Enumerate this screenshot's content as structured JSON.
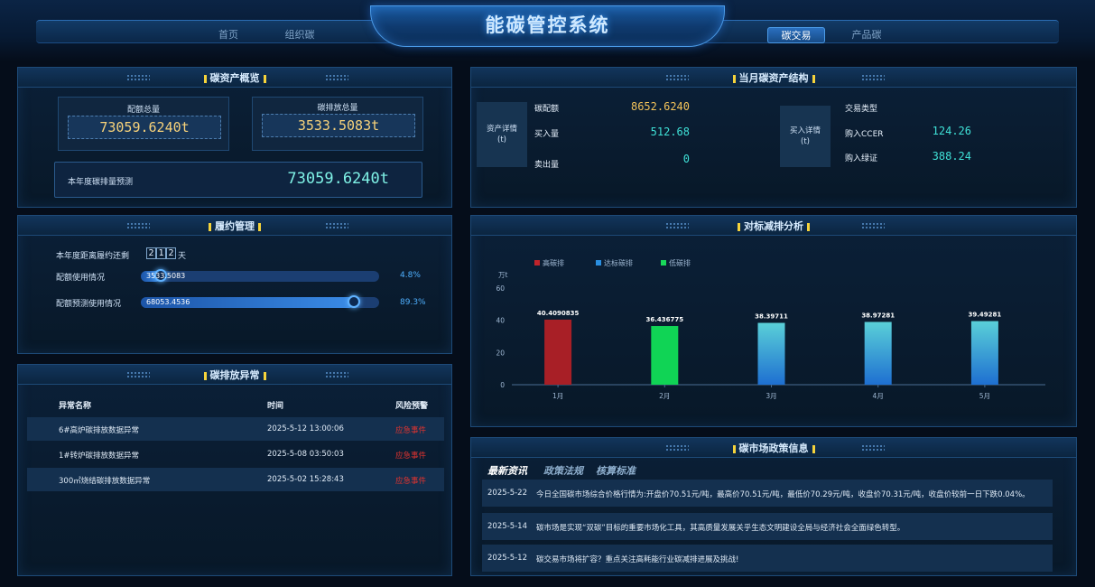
{
  "header": {
    "title": "能碳管控系统",
    "nav_left": [
      "首页",
      "组织碳"
    ],
    "nav_right": [
      "碳交易",
      "产品碳"
    ],
    "active_nav": "碳交易"
  },
  "carbon_assets": {
    "title": "碳资产概览",
    "quota_total_label": "配额总量",
    "quota_total_value": "73059.6240t",
    "emission_total_label": "碳排放总量",
    "emission_total_value": "3533.5083t",
    "forecast_label": "本年度碳排量预测",
    "forecast_value": "73059.6240t"
  },
  "compliance": {
    "title": "履约管理",
    "days_label": "本年度距离履约还剩",
    "days_digits": [
      "2",
      "1",
      "2"
    ],
    "days_unit": "天",
    "rows": [
      {
        "label": "配额使用情况",
        "value": "3533.5083",
        "percent": "4.8%",
        "fraction": 0.048
      },
      {
        "label": "配额预测使用情况",
        "value": "68053.4536",
        "percent": "89.3%",
        "fraction": 0.893
      }
    ]
  },
  "anomalies": {
    "title": "碳排放异常",
    "columns": [
      "异常名称",
      "时间",
      "风险预警"
    ],
    "rows": [
      {
        "name": "6#高炉碳排放数据异常",
        "time": "2025-5-12 13:00:06",
        "risk": "应急事件"
      },
      {
        "name": "1#转炉碳排放数据异常",
        "time": "2025-5-08 03:50:03",
        "risk": "应急事件"
      },
      {
        "name": "300㎡烧结碳排放数据异常",
        "time": "2025-5-02 15:28:43",
        "risk": "应急事件"
      }
    ]
  },
  "asset_structure": {
    "title": "当月碳资产结构",
    "asset_detail_label": "资产详情\n(t)",
    "asset_rows": [
      {
        "label": "碳配额",
        "value": "8652.6240",
        "color": "#f3c35a"
      },
      {
        "label": "买入量",
        "value": "512.68",
        "color": "#3fe0d6"
      },
      {
        "label": "卖出量",
        "value": "0",
        "color": "#3fe0d6"
      }
    ],
    "buy_detail_label": "买入详情\n(t)",
    "trade_type_label": "交易类型",
    "buy_rows": [
      {
        "label": "购入CCER",
        "value": "124.26"
      },
      {
        "label": "购入绿证",
        "value": "388.24"
      }
    ]
  },
  "benchmark": {
    "title": "对标减排分析"
  },
  "chart_data": {
    "type": "bar",
    "categories": [
      "1月",
      "2月",
      "3月",
      "4月",
      "5月"
    ],
    "values": [
      40.4090835,
      36.436775,
      38.39711,
      38.97281,
      39.49281
    ],
    "value_labels": [
      "40.4090835",
      "36.436775",
      "38.39711",
      "38.97281",
      "39.49281"
    ],
    "bar_categories": [
      "高碳排",
      "达标碳排",
      "达标碳排",
      "达标碳排",
      "达标碳排"
    ],
    "legend": [
      {
        "name": "高碳排",
        "color": "#c0242b"
      },
      {
        "name": "达标碳排",
        "color": "#2a8fe0"
      },
      {
        "name": "低碳排",
        "color": "#19d85a"
      }
    ],
    "bar_colors": [
      "#a81f26",
      "#10d455",
      "#3a9be0",
      "#3a9be0",
      "#3a9be0"
    ],
    "yunit": "万t",
    "yticks": [
      0,
      20,
      40,
      60
    ],
    "ylim": [
      0,
      60
    ],
    "xlabel": "",
    "ylabel": "万t",
    "grid": false,
    "legend_position": "top-left"
  },
  "market_news": {
    "title": "碳市场政策信息",
    "tabs": [
      "最新资讯",
      "政策法规",
      "核算标准"
    ],
    "active_tab": "最新资讯",
    "items": [
      {
        "date": "2025-5-22",
        "text": "今日全国碳市场综合价格行情为:开盘价70.51元/吨，最高价70.51元/吨，最低价70.29元/吨，收盘价70.31元/吨，收盘价较前一日下跌0.04%。"
      },
      {
        "date": "2025-5-14",
        "text": "碳市场是实现“双碳”目标的重要市场化工具，其高质量发展关乎生态文明建设全局与经济社会全面绿色转型。"
      },
      {
        "date": "2025-5-12",
        "text": "碳交易市场将扩容？重点关注高耗能行业碳减排进展及挑战!"
      }
    ]
  }
}
